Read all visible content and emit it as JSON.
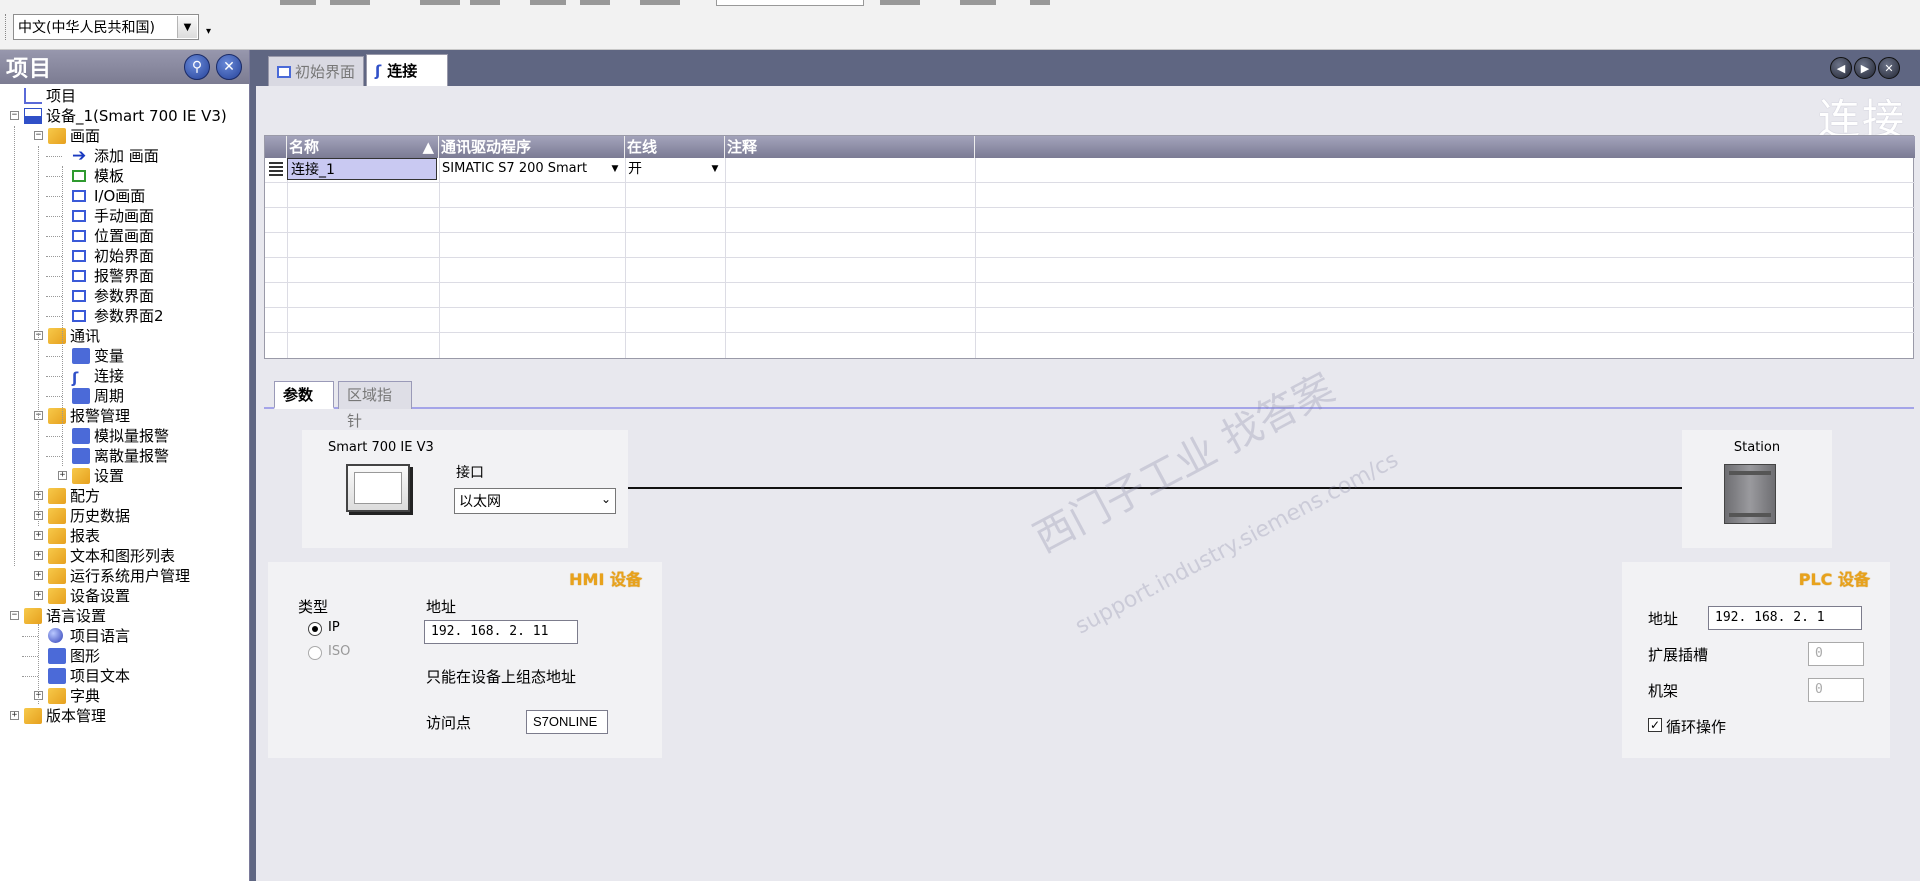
{
  "toolbar": {
    "language_select": "中文(中华人民共和国)"
  },
  "left_pane": {
    "title": "项目",
    "tree": [
      {
        "label": "项目",
        "level": 0,
        "icon": "project-icon"
      },
      {
        "label": "设备_1(Smart 700 IE V3)",
        "level": 0,
        "icon": "device-icon",
        "expand": "minus"
      },
      {
        "label": "画面",
        "level": 1,
        "icon": "folder-icon",
        "expand": "minus"
      },
      {
        "label": "添加 画面",
        "level": 2,
        "icon": "add-screen-icon"
      },
      {
        "label": "模板",
        "level": 2,
        "icon": "template-icon"
      },
      {
        "label": "I/O画面",
        "level": 2,
        "icon": "screen-icon"
      },
      {
        "label": "手动画面",
        "level": 2,
        "icon": "screen-icon"
      },
      {
        "label": "位置画面",
        "level": 2,
        "icon": "screen-icon"
      },
      {
        "label": "初始界面",
        "level": 2,
        "icon": "screen-icon"
      },
      {
        "label": "报警界面",
        "level": 2,
        "icon": "screen-icon"
      },
      {
        "label": "参数界面",
        "level": 2,
        "icon": "screen-icon"
      },
      {
        "label": "参数界面2",
        "level": 2,
        "icon": "screen-icon"
      },
      {
        "label": "通讯",
        "level": 1,
        "icon": "folder-icon",
        "expand": "minus"
      },
      {
        "label": "变量",
        "level": 2,
        "icon": "tags-icon"
      },
      {
        "label": "连接",
        "level": 2,
        "icon": "connection-icon"
      },
      {
        "label": "周期",
        "level": 2,
        "icon": "cycle-icon"
      },
      {
        "label": "报警管理",
        "level": 1,
        "icon": "folder-icon",
        "expand": "minus"
      },
      {
        "label": "模拟量报警",
        "level": 2,
        "icon": "analog-alarm-icon"
      },
      {
        "label": "离散量报警",
        "level": 2,
        "icon": "discrete-alarm-icon"
      },
      {
        "label": "设置",
        "level": 2,
        "icon": "folder-icon",
        "expand": "plus"
      },
      {
        "label": "配方",
        "level": 1,
        "icon": "folder-icon",
        "expand": "plus"
      },
      {
        "label": "历史数据",
        "level": 1,
        "icon": "folder-icon",
        "expand": "plus"
      },
      {
        "label": "报表",
        "level": 1,
        "icon": "folder-icon",
        "expand": "plus"
      },
      {
        "label": "文本和图形列表",
        "level": 1,
        "icon": "folder-icon",
        "expand": "plus"
      },
      {
        "label": "运行系统用户管理",
        "level": 1,
        "icon": "folder-icon",
        "expand": "plus"
      },
      {
        "label": "设备设置",
        "level": 1,
        "icon": "folder-icon",
        "expand": "plus"
      },
      {
        "label": "语言设置",
        "level": 0,
        "icon": "folder-icon",
        "expand": "minus"
      },
      {
        "label": "项目语言",
        "level": 1,
        "icon": "globe-icon"
      },
      {
        "label": "图形",
        "level": 1,
        "icon": "graphics-icon"
      },
      {
        "label": "项目文本",
        "level": 1,
        "icon": "text-icon"
      },
      {
        "label": "字典",
        "level": 1,
        "icon": "folder-icon",
        "expand": "plus"
      },
      {
        "label": "版本管理",
        "level": 0,
        "icon": "folder-icon",
        "expand": "plus"
      }
    ]
  },
  "tabs": [
    {
      "label": "初始界面",
      "active": false
    },
    {
      "label": "连接",
      "active": true
    }
  ],
  "editor": {
    "title": "连接",
    "grid": {
      "columns": [
        "名称",
        "通讯驱动程序",
        "在线",
        "注释"
      ],
      "rows": [
        {
          "name": "连接_1",
          "driver": "SIMATIC S7 200 Smart",
          "online": "开",
          "comment": ""
        }
      ]
    },
    "subtabs": [
      "参数",
      "区域指针"
    ],
    "hmi_device": {
      "model": "Smart 700 IE V3",
      "interface_label": "接口",
      "interface_value": "以太网",
      "section_title": "HMI 设备",
      "type_label": "类型",
      "type_ip": "IP",
      "type_iso": "ISO",
      "address_label": "地址",
      "address_value": "192. 168.   2.  11",
      "note": "只能在设备上组态地址",
      "access_point_label": "访问点",
      "access_point_value": "S7ONLINE"
    },
    "plc_device": {
      "station_label": "Station",
      "section_title": "PLC 设备",
      "address_label": "地址",
      "address_value": "192. 168.   2.   1",
      "slot_label": "扩展插槽",
      "slot_value": "0",
      "rack_label": "机架",
      "rack_value": "0",
      "cyclic_label": "循环操作",
      "cyclic_checked": true
    },
    "watermark": [
      "西门子工业  找答案",
      "support.industry.siemens.com/cs"
    ]
  },
  "colors": {
    "title_bar": "#8a8aa0",
    "tab_area": "#5f6682",
    "section_title": "#e8a21c",
    "selected_cell": "#c9c9f2"
  }
}
